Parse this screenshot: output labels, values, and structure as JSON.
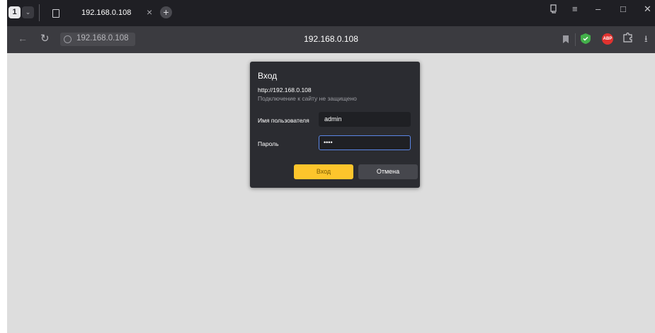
{
  "browser": {
    "tab_count": "1",
    "tab_title": "192.168.0.108",
    "address_host": "192.168.0.108",
    "page_title": "192.168.0.108",
    "adblock_badge": "ABP"
  },
  "dialog": {
    "title": "Вход",
    "url": "http://192.168.0.108",
    "warning": "Подключение к сайту не защищено",
    "username_label": "Имя пользователя",
    "username_value": "admin",
    "password_label": "Пароль",
    "password_value": "••••",
    "login_button": "Вход",
    "cancel_button": "Отмена"
  },
  "colors": {
    "accent_button": "#fdc52c",
    "focus_border": "#5b86e6",
    "dialog_bg": "#2b2c31",
    "page_bg": "#dddddd"
  }
}
